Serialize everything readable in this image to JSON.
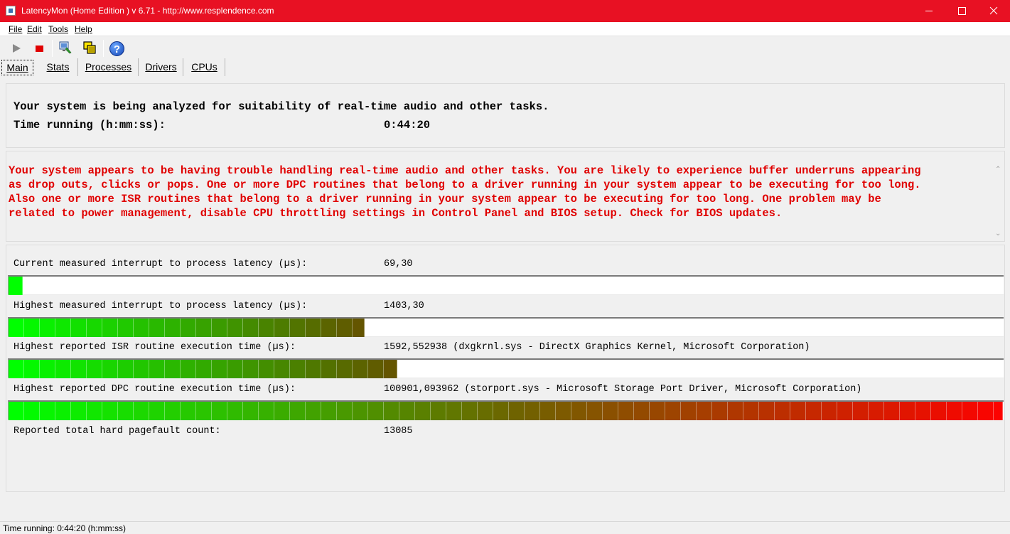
{
  "window": {
    "title": "LatencyMon  (Home Edition )  v 6.71 - http://www.resplendence.com"
  },
  "menu": [
    "File",
    "Edit",
    "Tools",
    "Help"
  ],
  "tabs": [
    "Main",
    "Stats",
    "Processes",
    "Drivers",
    "CPUs"
  ],
  "analysis": {
    "message": "Your system is being analyzed for suitability of real-time audio and other tasks.",
    "time_label": "Time running (h:mm:ss):",
    "time_value": "0:44:20"
  },
  "warning": {
    "text": "Your system appears to be having trouble handling real-time audio and other tasks. You are likely to experience buffer underruns appearing\nas drop outs, clicks or pops. One or more DPC routines that belong to a driver running in your system appear to be executing for too long.\nAlso one or more ISR routines that belong to a driver running in your system appear to be executing for too long. One problem may be\nrelated to power management, disable CPU throttling settings in Control Panel and BIOS setup. Check for BIOS updates."
  },
  "metrics": {
    "current_latency_label": "Current measured interrupt to process latency (µs):",
    "current_latency_value": "69,30",
    "current_latency_level": 0.014,
    "highest_latency_label": "Highest measured interrupt to process latency (µs):",
    "highest_latency_value": "1403,30",
    "highest_latency_level": 0.358,
    "isr_label": "Highest reported ISR routine execution time (µs):",
    "isr_value": "1592,552938   (dxgkrnl.sys - DirectX Graphics Kernel, Microsoft Corporation)",
    "isr_level": 0.391,
    "dpc_label": "Highest reported DPC routine execution time (µs):",
    "dpc_value": "100901,093962   (storport.sys - Microsoft Storage Port Driver, Microsoft Corporation)",
    "dpc_level": 1.0,
    "pagefault_label": "Reported total hard pagefault count:",
    "pagefault_value": "13085"
  },
  "status": {
    "text": "Time running: 0:44:20  (h:mm:ss)"
  },
  "colors": {
    "titlebar": "#e81123",
    "warning_text": "#e00000",
    "bar_start": "#00ff00",
    "bar_end": "#ff0000"
  }
}
